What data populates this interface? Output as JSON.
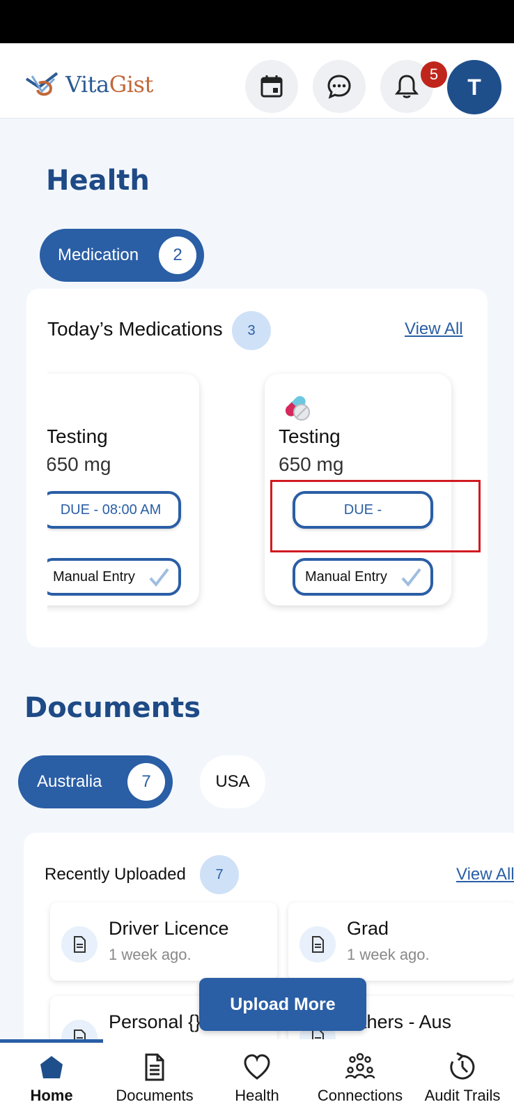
{
  "header": {
    "logo_vita": "Vita",
    "logo_gist": "Gist",
    "notification_count": "5",
    "avatar_initial": "T"
  },
  "health": {
    "title": "Health",
    "medication_pill_label": "Medication",
    "medication_pill_count": "2",
    "todays_title": "Today’s Medications",
    "todays_count": "3",
    "view_all": "View All",
    "cards": [
      {
        "name": "Testing",
        "name_visible": "ting",
        "dose": "650 mg",
        "dose_visible": "mg",
        "due": "DUE - 08:00 AM",
        "due_visible": "DUE - 08:00 AM",
        "manual": "Manual Entry",
        "manual_visible": "anual Entry"
      },
      {
        "name": "Testing",
        "dose": "650 mg",
        "due": "DUE -",
        "manual": "Manual Entry"
      }
    ]
  },
  "documents": {
    "title": "Documents",
    "tabs": [
      {
        "label": "Australia",
        "count": "7",
        "active": true
      },
      {
        "label": "USA",
        "active": false
      }
    ],
    "recently_uploaded": "Recently Uploaded",
    "recent_count": "7",
    "view_all": "View All",
    "items": [
      {
        "title": "Driver Licence",
        "time": "1 week ago."
      },
      {
        "title": "Grad",
        "time": "1 week ago."
      },
      {
        "title": "Personal {}",
        "time": ""
      },
      {
        "title": "Others - Aus",
        "title_visible": "thers - Aus",
        "time": ""
      }
    ],
    "upload_button": "Upload More"
  },
  "nav": {
    "items": [
      {
        "label": "Home",
        "icon": "home-icon",
        "active": true
      },
      {
        "label": "Documents",
        "icon": "document-icon"
      },
      {
        "label": "Health",
        "icon": "heart-icon"
      },
      {
        "label": "Connections",
        "icon": "connections-icon"
      },
      {
        "label": "Audit Trails",
        "icon": "audit-icon"
      }
    ]
  },
  "colors": {
    "primary": "#2a5ea5",
    "title": "#1e4a86",
    "badge": "#c0251c",
    "highlight": "#d11a22"
  }
}
